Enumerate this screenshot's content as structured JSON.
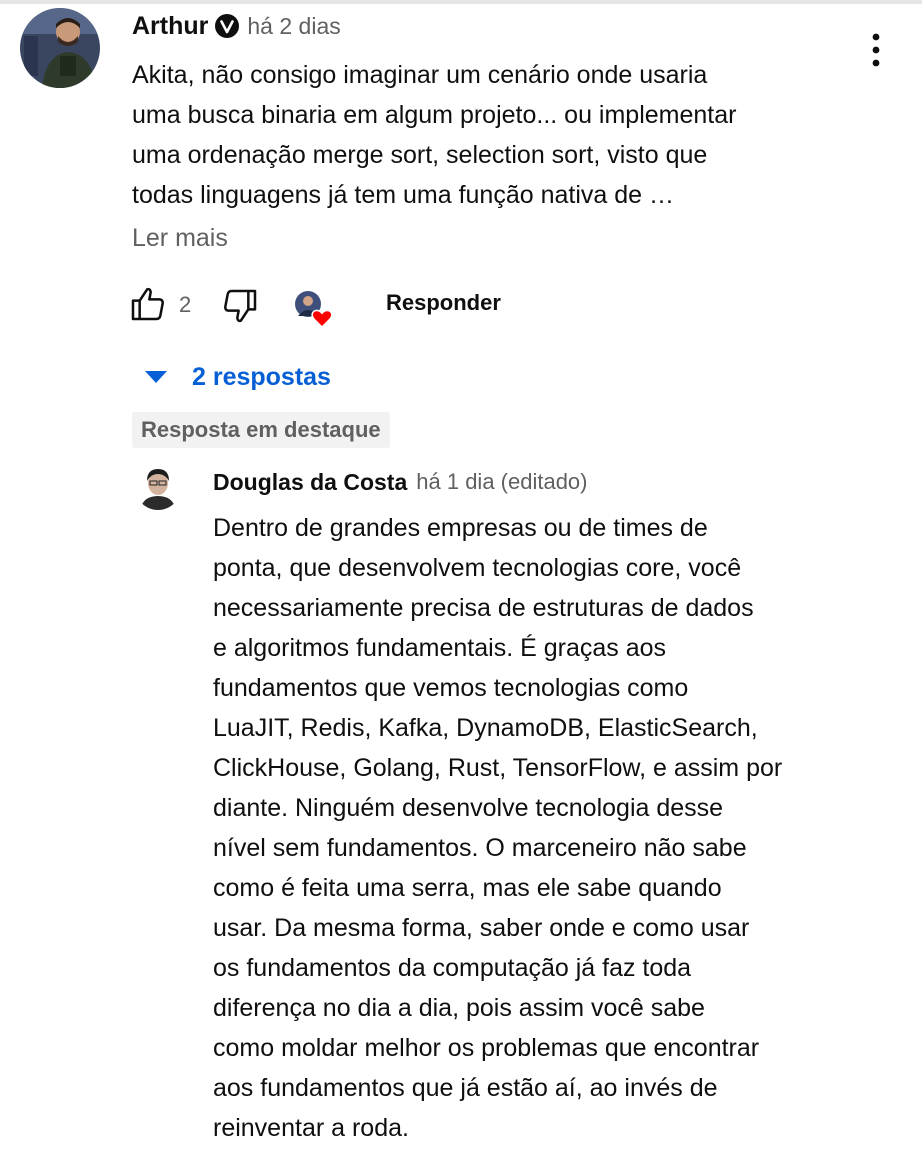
{
  "comment": {
    "author": "Arthur",
    "verified_icon": "verified-icon",
    "timestamp": "há 2 dias",
    "text": "Akita, não consigo imaginar um cenário onde usaria\numa busca binaria em algum projeto... ou implementar\numa ordenação merge sort, selection sort, visto que\ntodas linguagens já tem uma função nativa de …",
    "read_more": "Ler mais",
    "like_count": "2",
    "reply_label": "Responder",
    "replies_toggle": "2 respostas",
    "more_icon": "more-vert-icon"
  },
  "reply": {
    "badge": "Resposta em destaque",
    "author": "Douglas da Costa",
    "timestamp": "há 1 dia (editado)",
    "text": "Dentro de grandes empresas ou de times de\nponta, que desenvolvem tecnologias core, você\nnecessariamente precisa de estruturas de dados\ne algoritmos fundamentais. É graças aos\nfundamentos que vemos tecnologias como\nLuaJIT, Redis, Kafka, DynamoDB, ElasticSearch,\nClickHouse, Golang, Rust, TensorFlow, e assim por\ndiante. Ninguém desenvolve tecnologia desse\nnível sem fundamentos. O marceneiro não sabe\ncomo é feita uma serra, mas ele sabe quando\nusar. Da mesma forma, saber onde e como usar\nos fundamentos da computação já faz toda\ndiferença no dia a dia, pois assim você sabe\ncomo moldar melhor os problemas que encontrar\naos fundamentos que já estão aí, ao invés de\nreinventar a roda."
  },
  "colors": {
    "link_blue": "#065fd4",
    "secondary_text": "#606060",
    "heart_red": "#ff0000",
    "badge_bg": "#f2f2f2"
  }
}
